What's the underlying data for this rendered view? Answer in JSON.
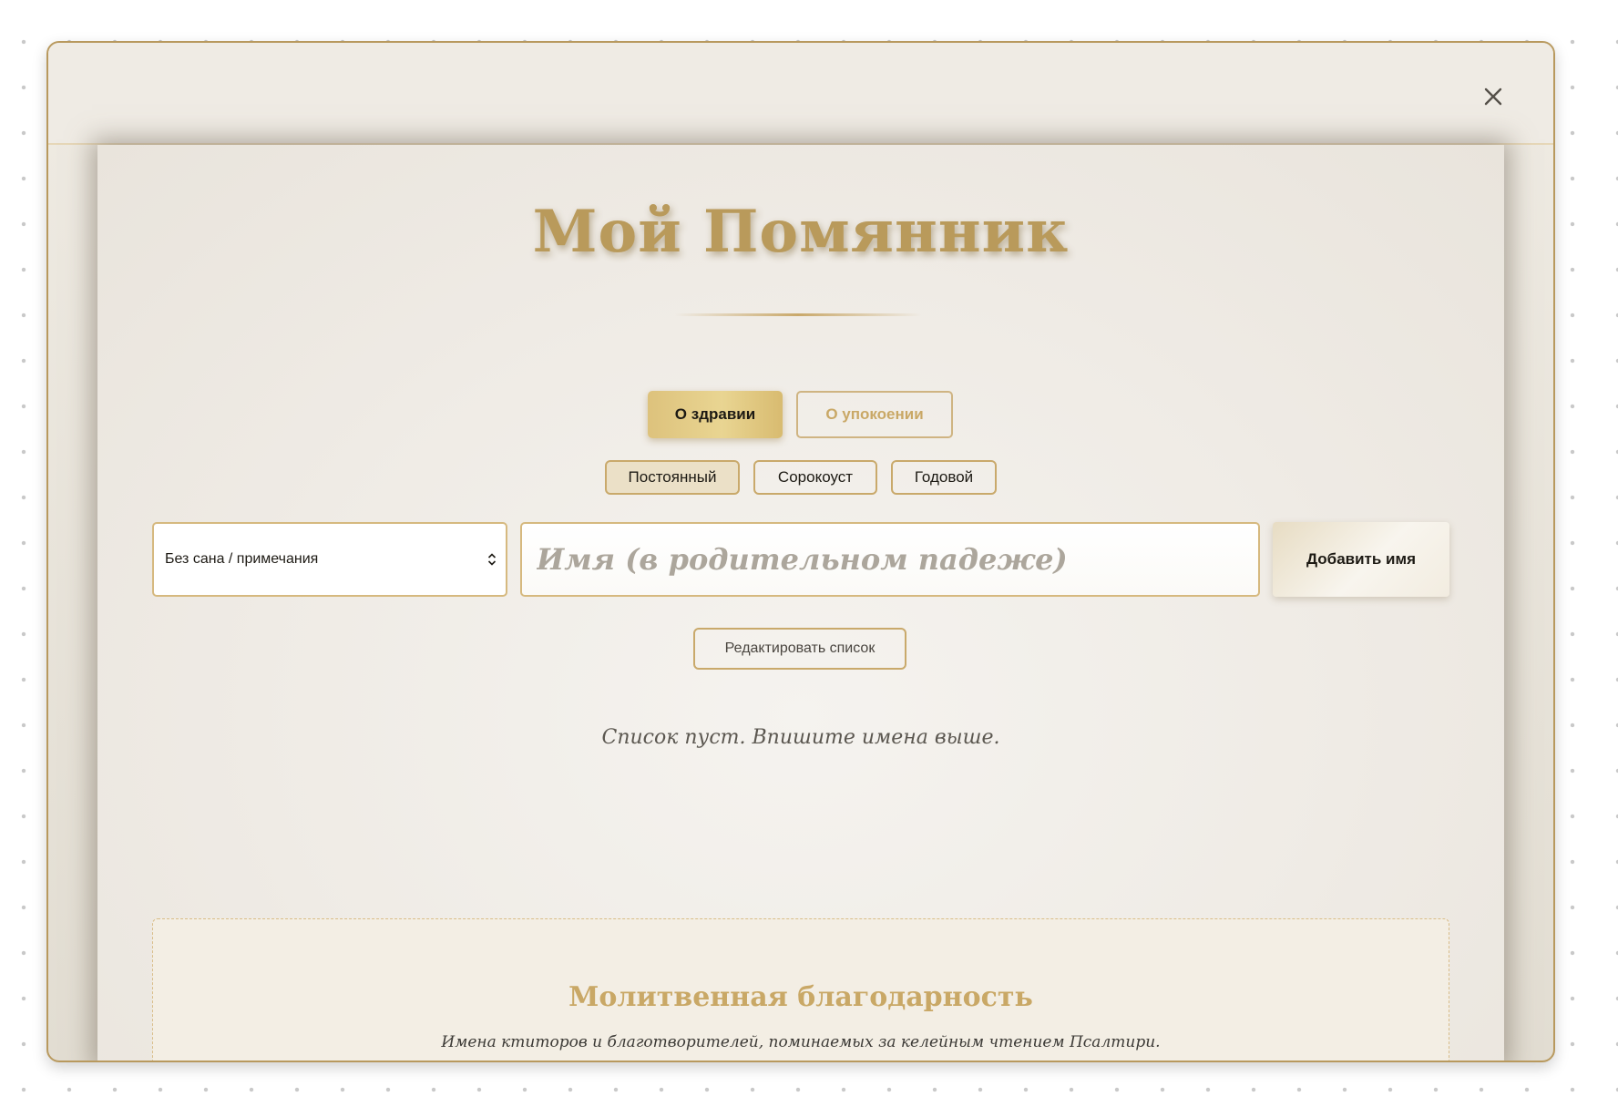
{
  "modal": {
    "close_label": "×",
    "title": "Мой Помянник",
    "tabs": [
      {
        "label": "О здравии",
        "active": true
      },
      {
        "label": "О упокоении",
        "active": false
      }
    ],
    "types": [
      {
        "label": "Постоянный",
        "active": true
      },
      {
        "label": "Сорокоуст",
        "active": false
      },
      {
        "label": "Годовой",
        "active": false
      }
    ],
    "rank_select": {
      "value": "Без сана / примечания"
    },
    "name_input": {
      "placeholder": "Имя (в родительном падеже)",
      "value": ""
    },
    "add_button": "Добавить имя",
    "edit_button": "Редактировать список",
    "empty_message": "Список пуст. Впишите имена выше.",
    "gratitude": {
      "title": "Молитвенная благодарность",
      "text": "Имена ктиторов и благотворителей, поминаемых за келейным чтением Псалтири."
    }
  },
  "colors": {
    "gold": "#c9a866",
    "gold_active": "#e9d592",
    "parchment": "#efebe4",
    "text_dark": "#1d1a14"
  },
  "icons": {
    "close": "close-icon",
    "select_arrows": "chevron-updown-icon"
  }
}
